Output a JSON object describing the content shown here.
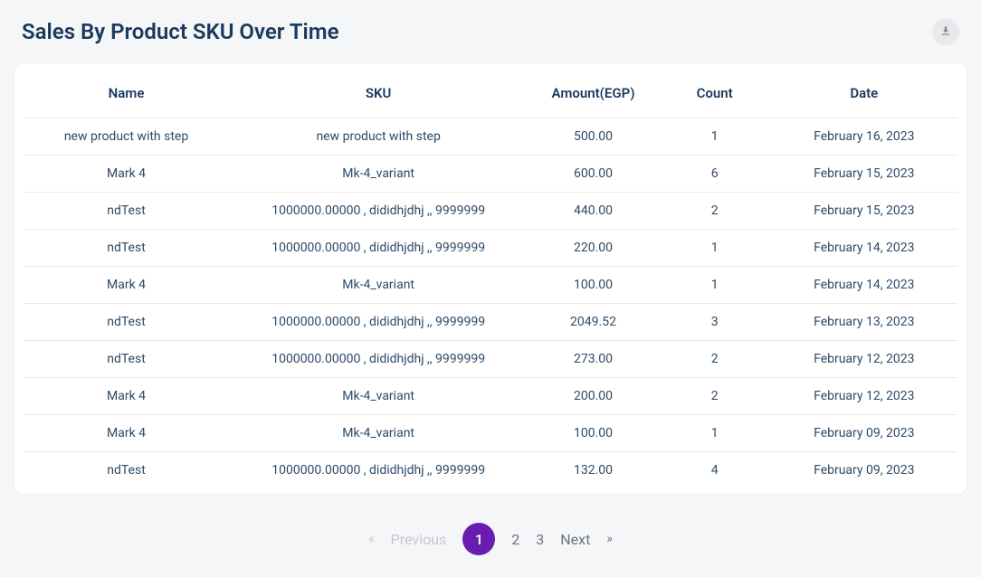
{
  "header": {
    "title": "Sales By Product SKU Over Time"
  },
  "table": {
    "columns": {
      "name": "Name",
      "sku": "SKU",
      "amount": "Amount(EGP)",
      "count": "Count",
      "date": "Date"
    },
    "rows": [
      {
        "name": "new product with step",
        "sku": "new product with step",
        "amount": "500.00",
        "count": "1",
        "date": "February 16, 2023"
      },
      {
        "name": "Mark 4",
        "sku": "Mk-4_variant",
        "amount": "600.00",
        "count": "6",
        "date": "February 15, 2023"
      },
      {
        "name": "ndTest",
        "sku": "1000000.00000 , dididhjdhj ,, 9999999",
        "amount": "440.00",
        "count": "2",
        "date": "February 15, 2023"
      },
      {
        "name": "ndTest",
        "sku": "1000000.00000 , dididhjdhj ,, 9999999",
        "amount": "220.00",
        "count": "1",
        "date": "February 14, 2023"
      },
      {
        "name": "Mark 4",
        "sku": "Mk-4_variant",
        "amount": "100.00",
        "count": "1",
        "date": "February 14, 2023"
      },
      {
        "name": "ndTest",
        "sku": "1000000.00000 , dididhjdhj ,, 9999999",
        "amount": "2049.52",
        "count": "3",
        "date": "February 13, 2023"
      },
      {
        "name": "ndTest",
        "sku": "1000000.00000 , dididhjdhj ,, 9999999",
        "amount": "273.00",
        "count": "2",
        "date": "February 12, 2023"
      },
      {
        "name": "Mark 4",
        "sku": "Mk-4_variant",
        "amount": "200.00",
        "count": "2",
        "date": "February 12, 2023"
      },
      {
        "name": "Mark 4",
        "sku": "Mk-4_variant",
        "amount": "100.00",
        "count": "1",
        "date": "February 09, 2023"
      },
      {
        "name": "ndTest",
        "sku": "1000000.00000 , dididhjdhj ,, 9999999",
        "amount": "132.00",
        "count": "4",
        "date": "February 09, 2023"
      }
    ]
  },
  "pagination": {
    "first_arrow": "«",
    "prev_label": "Previous",
    "next_label": "Next",
    "last_arrow": "»",
    "pages": [
      "1",
      "2",
      "3"
    ],
    "active_index": 0
  }
}
